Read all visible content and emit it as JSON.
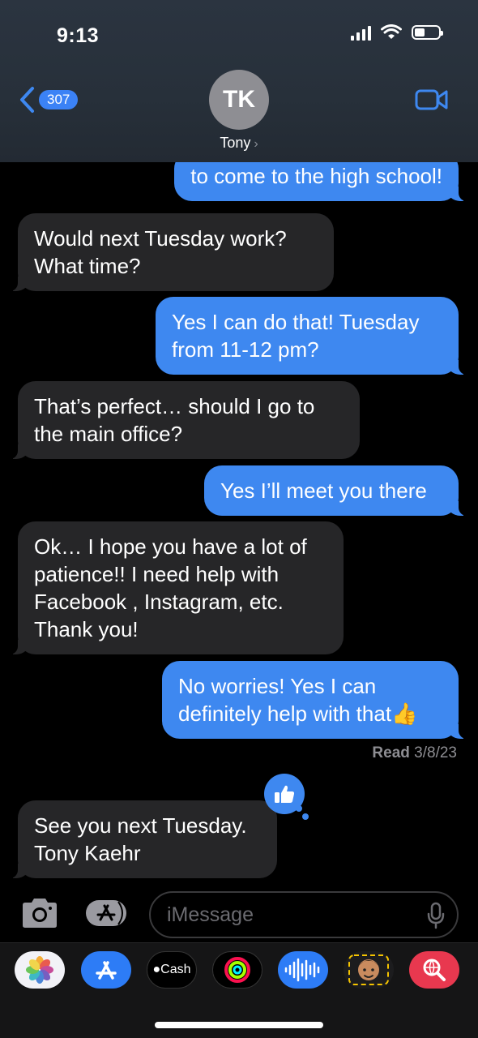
{
  "status_bar": {
    "time": "9:13"
  },
  "header": {
    "back_count": "307",
    "avatar_initials": "TK",
    "contact_name": "Tony",
    "chevron": "›"
  },
  "messages": [
    {
      "direction": "outgoing",
      "lines": [
        "to come to the high school!"
      ]
    },
    {
      "direction": "incoming",
      "lines": [
        "Would next Tuesday work?",
        "What time?"
      ]
    },
    {
      "direction": "outgoing",
      "lines": [
        "Yes I can do that! Tuesday",
        "from 11-12 pm?"
      ]
    },
    {
      "direction": "incoming",
      "lines": [
        "That’s perfect… should I go to",
        "the main office?"
      ]
    },
    {
      "direction": "outgoing",
      "lines": [
        "Yes I’ll meet you there"
      ]
    },
    {
      "direction": "incoming",
      "lines": [
        "Ok… I hope you have a lot of",
        "patience!! I need help with",
        "Facebook , Instagram, etc.",
        "Thank you!"
      ]
    },
    {
      "direction": "outgoing",
      "lines": [
        "No worries! Yes I can",
        "definitely help with that👍"
      ]
    },
    {
      "direction": "incoming",
      "lines": [
        "See you next Tuesday.",
        "Tony Kaehr"
      ],
      "tapback": "thumbs-up-icon"
    }
  ],
  "read_receipt": {
    "label": "Read",
    "date": "3/8/23"
  },
  "compose": {
    "placeholder": "iMessage"
  },
  "app_drawer": {
    "apps": [
      "photos-icon",
      "app-store-icon",
      "apple-cash-icon",
      "activity-icon",
      "audio-message-icon",
      "memoji-icon",
      "web-search-icon"
    ],
    "cash_label": "Cash"
  },
  "colors": {
    "outgoing_bubble": "#3e88f0",
    "incoming_bubble": "#262628",
    "header_bg": "#2b3440",
    "badge": "#3b82f6"
  }
}
